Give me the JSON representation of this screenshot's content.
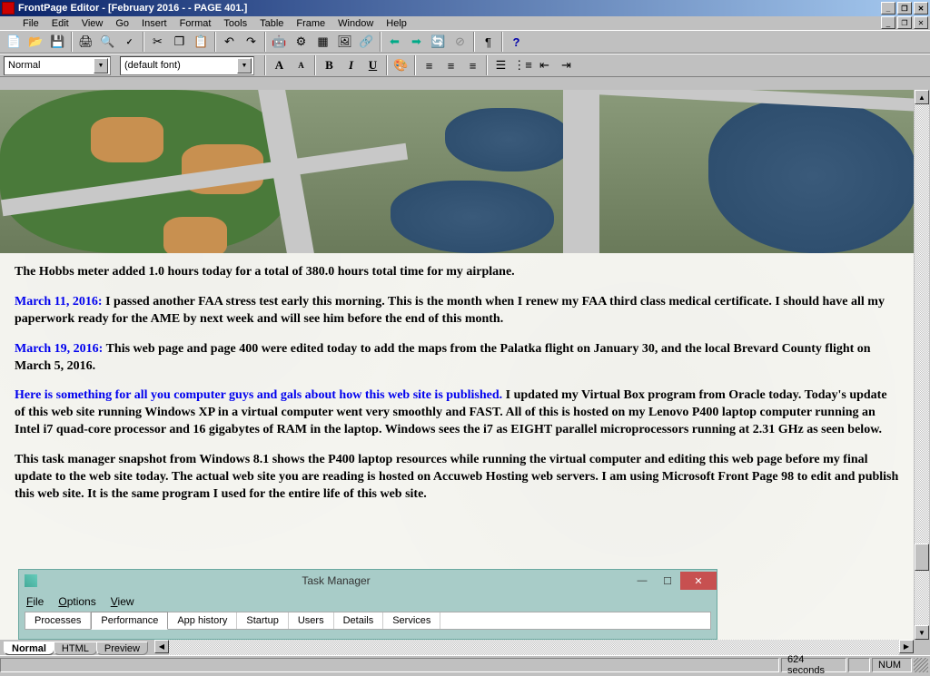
{
  "title": "FrontPage Editor - [February 2016 - - PAGE 401.]",
  "menu": [
    "File",
    "Edit",
    "View",
    "Go",
    "Insert",
    "Format",
    "Tools",
    "Table",
    "Frame",
    "Window",
    "Help"
  ],
  "style_combo": "Normal",
  "font_combo": "(default font)",
  "doc": {
    "p1": "The Hobbs meter added 1.0 hours today for a total of 380.0 hours total time for my airplane.",
    "date1": "March 11, 2016:",
    "p2": "  I passed another FAA stress test early this morning.  This is the month when I renew my FAA third class medical certificate.  I should have all my paperwork ready for the AME by next week and will see him before the end of this month.",
    "date2": "March 19, 2016:",
    "p3": "  This web page and page 400 were edited today to add the maps from the Palatka flight on January 30, and the local Brevard County flight on March 5, 2016.",
    "link1": "Here is something for all you computer guys and gals about how this web site is published.",
    "p4": "  I updated my Virtual Box program from Oracle today.  Today's update of this web site running Windows XP in a virtual computer went very smoothly and FAST.  All of this is hosted on my Lenovo P400 laptop computer running an Intel i7 quad-core processor and 16 gigabytes of RAM in the laptop.   Windows sees the i7 as EIGHT parallel microprocessors running at 2.31 GHz as seen below.",
    "p5": "This task manager snapshot from Windows 8.1 shows the P400 laptop resources while running the virtual computer and editing this web page before my final update to the web site today.  The actual web site you are reading is hosted on Accuweb Hosting web servers.  I am using Microsoft Front Page 98 to edit and publish this web site.   It is the same program I used for the entire life of this web site."
  },
  "tm": {
    "title": "Task Manager",
    "menu": [
      "File",
      "Options",
      "View"
    ],
    "tabs": [
      "Processes",
      "Performance",
      "App history",
      "Startup",
      "Users",
      "Details",
      "Services"
    ],
    "active_tab": "Performance"
  },
  "viewtabs": [
    "Normal",
    "HTML",
    "Preview"
  ],
  "active_viewtab": "Normal",
  "status": {
    "seconds": "624 seconds",
    "num": "NUM"
  }
}
